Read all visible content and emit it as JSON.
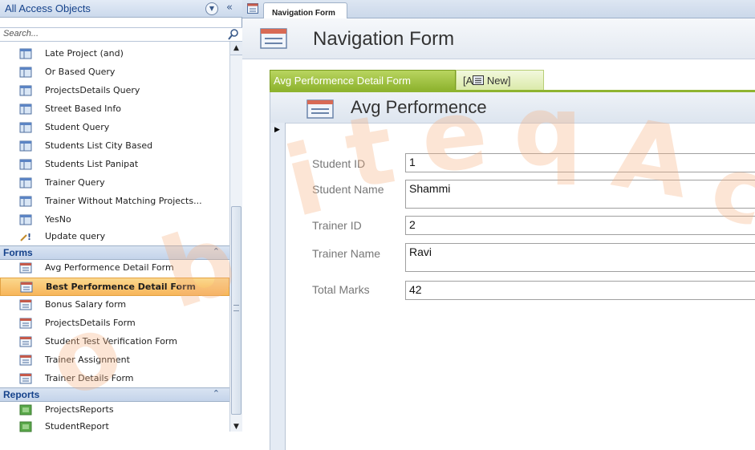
{
  "nav_pane": {
    "title": "All Access Objects",
    "search_placeholder": "Search...",
    "query_items": [
      {
        "label": "Late Project (and)",
        "icon": "query-icon"
      },
      {
        "label": "Or Based Query",
        "icon": "query-icon"
      },
      {
        "label": "ProjectsDetails Query",
        "icon": "query-icon"
      },
      {
        "label": "Street Based Info",
        "icon": "query-icon"
      },
      {
        "label": "Student Query",
        "icon": "query-icon"
      },
      {
        "label": "Students List City Based",
        "icon": "query-icon"
      },
      {
        "label": "Students List Panipat",
        "icon": "query-icon"
      },
      {
        "label": "Trainer Query",
        "icon": "query-icon"
      },
      {
        "label": "Trainer Without Matching Projects...",
        "icon": "query-icon"
      },
      {
        "label": "YesNo",
        "icon": "query-icon"
      },
      {
        "label": "Update query",
        "icon": "update-query-icon"
      }
    ],
    "forms_group": {
      "label": "Forms",
      "items": [
        {
          "label": "Avg Performence Detail Form"
        },
        {
          "label": "Best Performence Detail Form",
          "selected": true
        },
        {
          "label": "Bonus Salary form"
        },
        {
          "label": "ProjectsDetails Form"
        },
        {
          "label": "Student Test Verification Form"
        },
        {
          "label": "Trainer Assignment"
        },
        {
          "label": "Trainer Details Form"
        }
      ]
    },
    "reports_group": {
      "label": "Reports",
      "items": [
        {
          "label": "ProjectsReports"
        },
        {
          "label": "StudentReport"
        }
      ]
    }
  },
  "document": {
    "tab_label": "Navigation Form",
    "form_title": "Navigation Form",
    "nav_tabs": {
      "active": "Avg Performence Detail Form",
      "new_prefix": "[A",
      "new_suffix": " New]"
    },
    "subform_title": "Avg Performence",
    "fields": [
      {
        "label": "Student ID",
        "value": "1"
      },
      {
        "label": "Student Name",
        "value": "Shammi"
      },
      {
        "label": "Trainer ID",
        "value": "2"
      },
      {
        "label": "Trainer Name",
        "value": "Ravi"
      },
      {
        "label": "Total Marks",
        "value": "42"
      }
    ]
  },
  "colors": {
    "accent_tab": "#8fb430",
    "selected_item": "#f7b55a",
    "nav_header_text": "#15428b",
    "watermark": "#f4b080"
  }
}
